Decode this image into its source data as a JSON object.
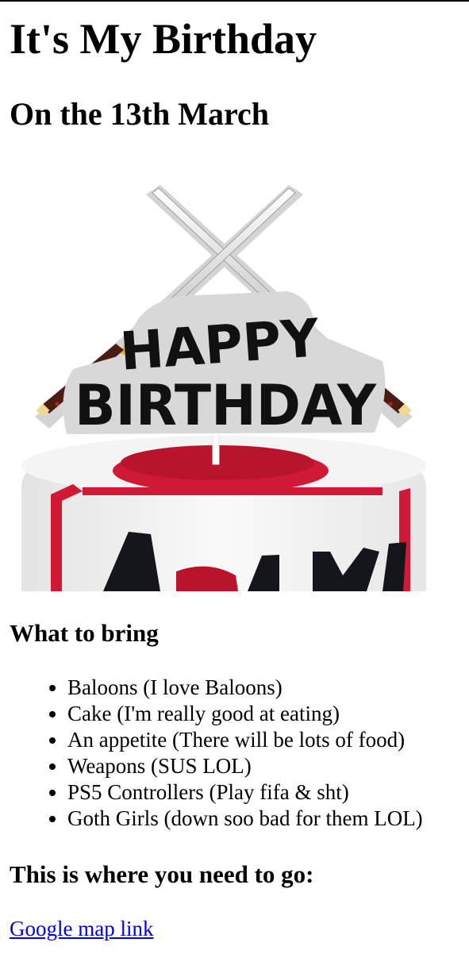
{
  "page": {
    "title": "It's My Birthday",
    "subtitle": "On the 13th March"
  },
  "image": {
    "topper_line1": "HAPPY",
    "topper_line2": "BIRTHDAY",
    "cake_letters": "ARKI",
    "colors": {
      "glitter_silver": "#d4d4d4",
      "topper_black": "#111111",
      "cake_red": "#d01a35",
      "cake_white": "#f1f1f1"
    }
  },
  "bring": {
    "heading": "What to bring",
    "items": [
      "Baloons (I love Baloons)",
      "Cake (I'm really good at eating)",
      "An appetite (There will be lots of food)",
      "Weapons (SUS LOL)",
      "PS5 Controllers (Play fifa & sht)",
      "Goth Girls (down soo bad for them LOL)"
    ]
  },
  "location": {
    "heading": "This is where you need to go:",
    "link_text": "Google map link"
  }
}
